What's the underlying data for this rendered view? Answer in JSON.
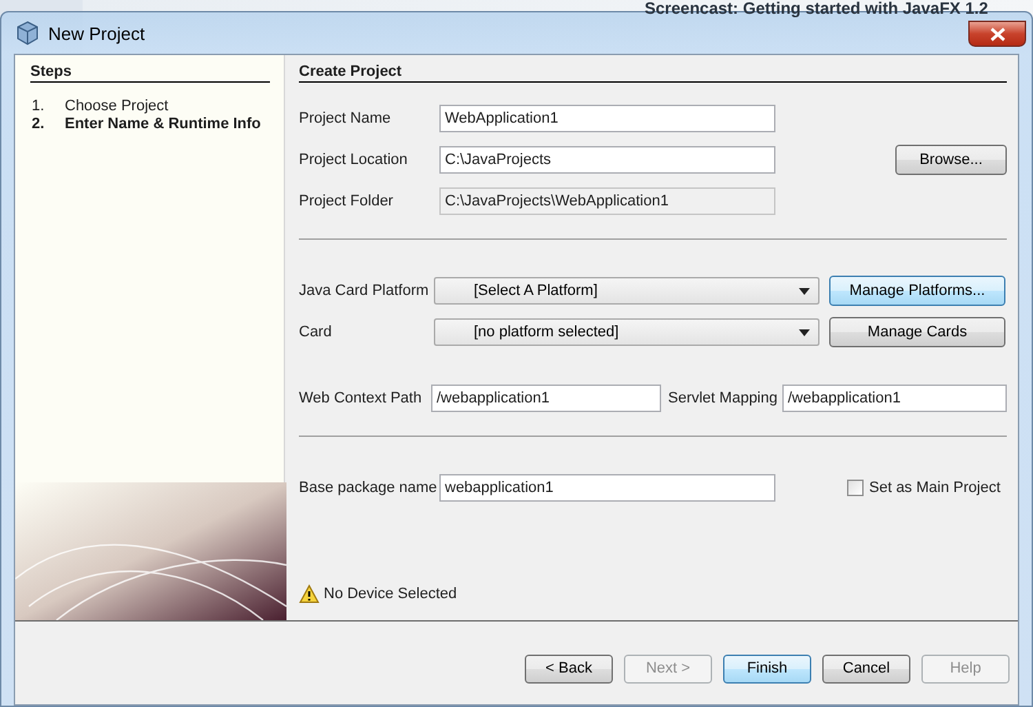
{
  "background": {
    "text": "Screencast: Getting started with JavaFX 1.2"
  },
  "window": {
    "title": "New Project"
  },
  "steps": {
    "title": "Steps",
    "items": [
      {
        "number": "1.",
        "label": "Choose Project",
        "selected": false
      },
      {
        "number": "2.",
        "label": "Enter Name & Runtime Info",
        "selected": true
      }
    ]
  },
  "form": {
    "title": "Create Project",
    "rows": [
      {
        "kind": "field",
        "label": "Project Name",
        "value": "WebApplication1",
        "readonly": false
      },
      {
        "kind": "field",
        "label": "Project Location",
        "value": "C:\\JavaProjects",
        "readonly": false,
        "button": "Browse..."
      },
      {
        "kind": "field",
        "label": "Project Folder",
        "value": "C:\\JavaProjects\\WebApplication1",
        "readonly": true
      },
      {
        "kind": "divider"
      },
      {
        "kind": "combo",
        "label": "Java Card Platform",
        "value": "[Select A Platform]",
        "button": "Manage Platforms...",
        "focused": true
      },
      {
        "kind": "combo",
        "label": "Card",
        "value": "[no platform selected]",
        "button": "Manage Cards",
        "focused": false
      },
      {
        "kind": "pair",
        "label": "Web Context Path",
        "value": "/webapplication1",
        "label2": "Servlet Mapping",
        "value2": "/webapplication1"
      },
      {
        "kind": "divider"
      },
      {
        "kind": "field_check",
        "label": "Base package name",
        "value": "webapplication1",
        "check_label": "Set as Main Project",
        "checked": false
      }
    ]
  },
  "status": {
    "message": "No Device Selected"
  },
  "buttons": [
    {
      "label": "< Back",
      "disabled": false,
      "default": false
    },
    {
      "label": "Next >",
      "disabled": true,
      "default": false
    },
    {
      "label": "Finish",
      "disabled": false,
      "default": true
    },
    {
      "label": "Cancel",
      "disabled": false,
      "default": false
    },
    {
      "label": "Help",
      "disabled": true,
      "default": false
    }
  ]
}
